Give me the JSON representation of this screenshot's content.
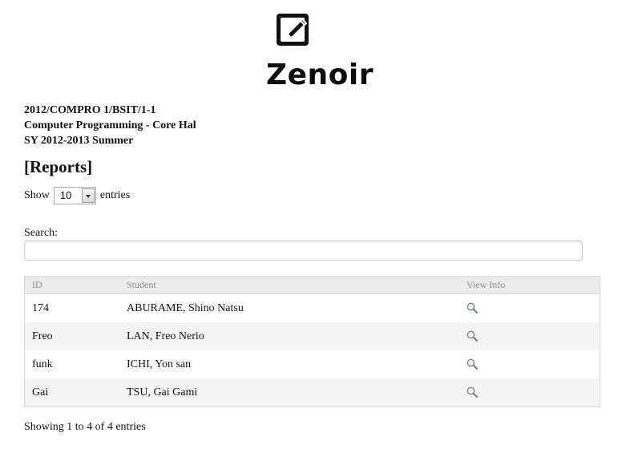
{
  "brand": {
    "name": "Zenoir",
    "logo_icon": "edit-icon"
  },
  "course": {
    "code": "2012/COMPRO 1/BSIT/1-1",
    "title": "Computer Programming - Core Hal",
    "term": "SY 2012-2013 Summer"
  },
  "page": {
    "title": "[Reports]"
  },
  "length": {
    "prefix": "Show",
    "value": "10",
    "suffix": "entries"
  },
  "search": {
    "label": "Search:",
    "value": "",
    "placeholder": ""
  },
  "table": {
    "columns": [
      "ID",
      "Student",
      "View Info"
    ],
    "rows": [
      {
        "id": "174",
        "student": "ABURAME, Shino Natsu",
        "icon": "search-icon"
      },
      {
        "id": "Freo",
        "student": "LAN, Freo Nerio",
        "icon": "search-icon"
      },
      {
        "id": "funk",
        "student": "ICHI, Yon san",
        "icon": "search-icon"
      },
      {
        "id": "Gai",
        "student": "TSU, Gai Gami",
        "icon": "search-icon"
      }
    ]
  },
  "footer": {
    "info": "Showing 1 to 4 of 4 entries"
  }
}
